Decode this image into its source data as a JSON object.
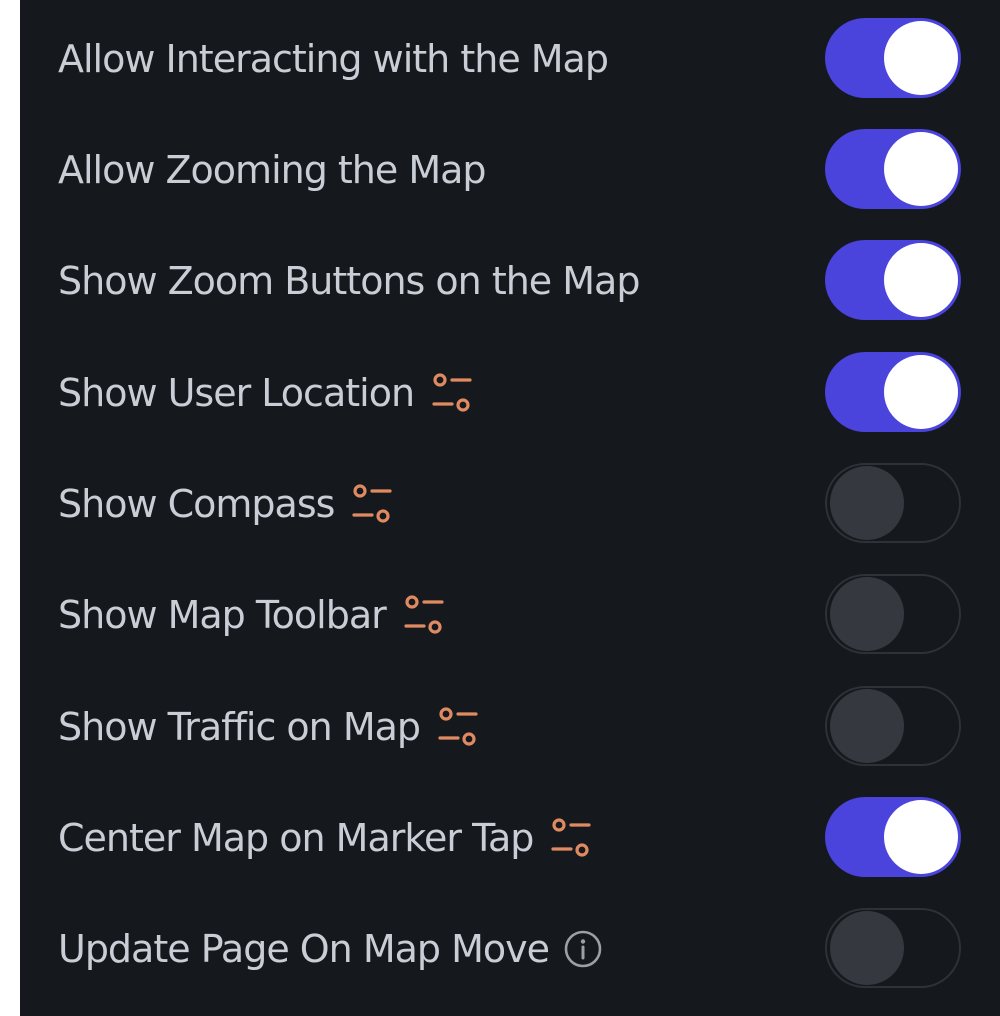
{
  "settings": [
    {
      "label": "Allow Interacting with the Map",
      "enabled": true,
      "icon": "none"
    },
    {
      "label": "Allow Zooming the Map",
      "enabled": true,
      "icon": "none"
    },
    {
      "label": "Show Zoom Buttons on the Map",
      "enabled": true,
      "icon": "none"
    },
    {
      "label": "Show User Location",
      "enabled": true,
      "icon": "sliders-icon"
    },
    {
      "label": "Show Compass",
      "enabled": false,
      "icon": "sliders-icon"
    },
    {
      "label": "Show Map Toolbar",
      "enabled": false,
      "icon": "sliders-icon"
    },
    {
      "label": "Show Traffic on Map",
      "enabled": false,
      "icon": "sliders-icon"
    },
    {
      "label": "Center Map on Marker Tap",
      "enabled": true,
      "icon": "sliders-icon"
    },
    {
      "label": "Update Page On Map Move",
      "enabled": false,
      "icon": "info-icon"
    }
  ],
  "colors": {
    "background": "#15181c",
    "label": "#c9ced6",
    "toggle_on": "#4a43dc",
    "toggle_off_knob": "#35393f",
    "sliders_icon": "#e08a62",
    "info_icon": "#9aa0a8"
  }
}
